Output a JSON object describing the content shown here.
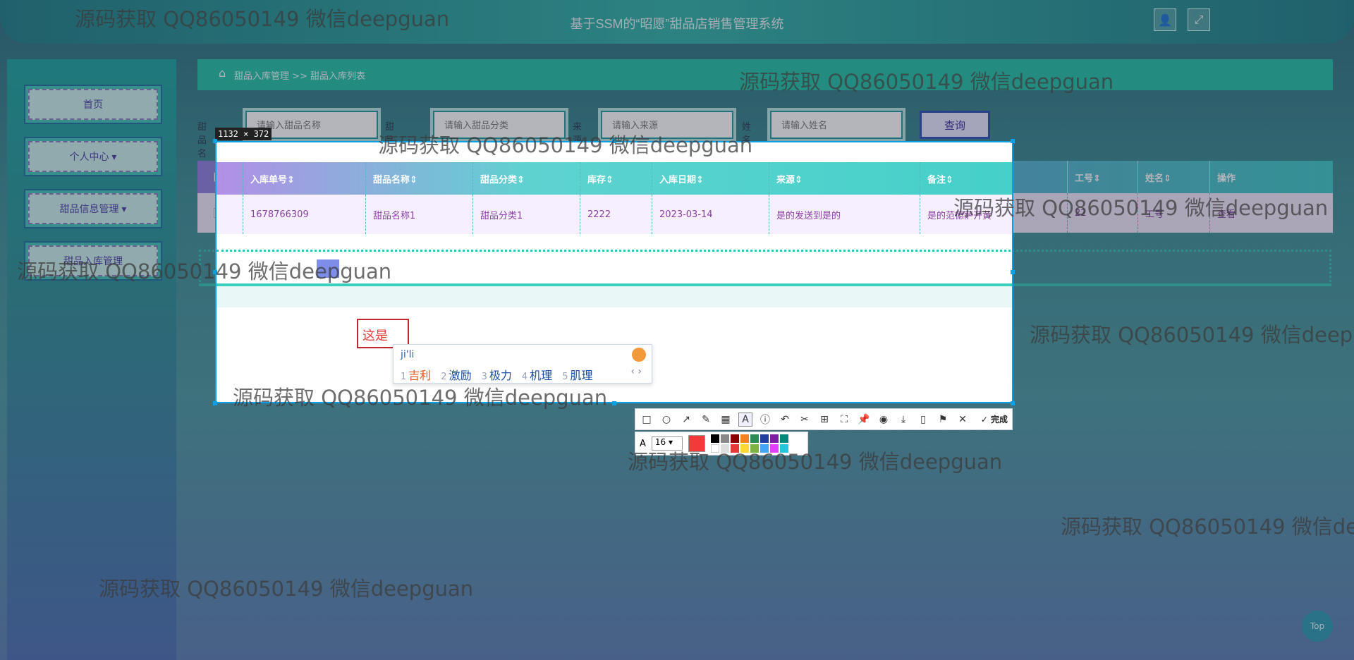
{
  "header": {
    "title": "基于SSM的“昭愿”甜品店销售管理系统"
  },
  "sidebar": {
    "items": [
      {
        "label": "首页"
      },
      {
        "label": "个人中心 ▾"
      },
      {
        "label": "甜品信息管理 ▾"
      },
      {
        "label": "甜品入库管理"
      }
    ]
  },
  "breadcrumb": {
    "text": "甜品入库管理 >> 甜品入库列表"
  },
  "search": {
    "labels": [
      "甜品名称",
      "甜品分类",
      "来源",
      "姓名"
    ],
    "placeholders": [
      "请输入甜品名称",
      "请输入甜品分类",
      "请输入来源",
      "请输入姓名"
    ],
    "button": "查询"
  },
  "table": {
    "headers": [
      "入库单号⇕",
      "甜品名称⇕",
      "甜品分类⇕",
      "库存⇕",
      "入库日期⇕",
      "来源⇕",
      "备注⇕",
      "工号⇕",
      "姓名⇕",
      "操作"
    ],
    "rows": [
      [
        "1678766309",
        "甜品名称1",
        "甜品分类1",
        "2222",
        "2023-03-14",
        "是的发送到是的",
        "是的范德萨开黄",
        "22",
        "工号",
        "查看"
      ]
    ]
  },
  "capture": {
    "size": "1132 × 372",
    "annotation_text": "这是",
    "ime": {
      "pinyin": "ji'li",
      "candidates": [
        {
          "n": "1",
          "w": "吉利"
        },
        {
          "n": "2",
          "w": "激励"
        },
        {
          "n": "3",
          "w": "极力"
        },
        {
          "n": "4",
          "w": "机理"
        },
        {
          "n": "5",
          "w": "肌理"
        }
      ]
    },
    "toolbar": {
      "done_label": "完成",
      "font_size": "16",
      "selected_color": "#f23a3a"
    }
  },
  "watermark": "源码获取 QQ86050149 微信deepguan",
  "top_button": "Top"
}
